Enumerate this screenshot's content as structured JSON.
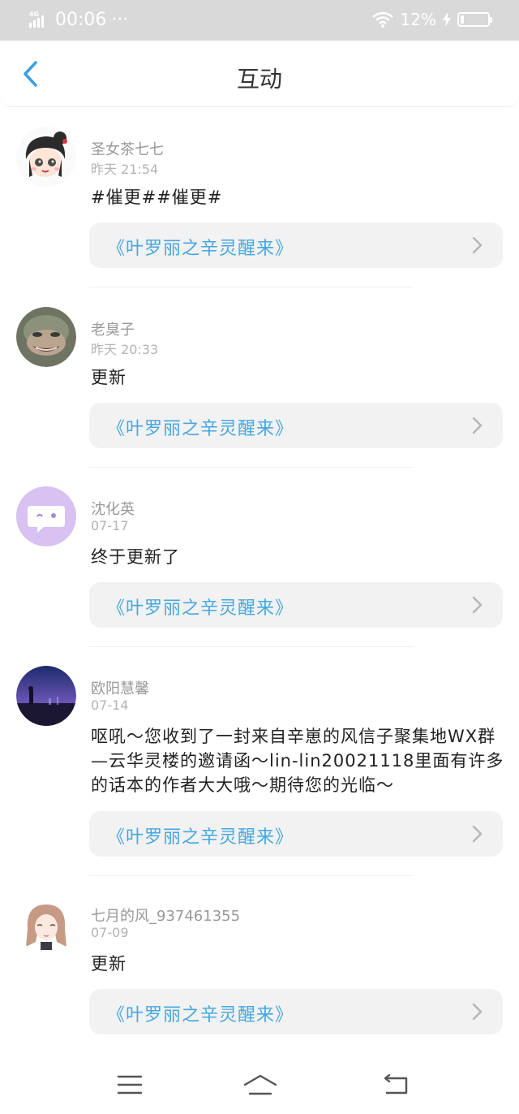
{
  "status": {
    "network": "4G HD",
    "time": "00:06",
    "dots": "···",
    "battery": "12%"
  },
  "header": {
    "title": "互动"
  },
  "posts": [
    {
      "name": "圣女茶七七",
      "time": "昨天 21:54",
      "content": "#催更##催更#",
      "book": "《叶罗丽之辛灵醒来》"
    },
    {
      "name": "老臭子",
      "time": "昨天 20:33",
      "content": "更新",
      "book": "《叶罗丽之辛灵醒来》"
    },
    {
      "name": "沈化英",
      "time": "07-17",
      "content": "终于更新了",
      "book": "《叶罗丽之辛灵醒来》"
    },
    {
      "name": "欧阳慧馨",
      "time": "07-14",
      "content": "呕吼～您收到了一封来自辛崽的风信子聚集地WX群—云华灵楼的邀请函～lin-lin20021118里面有许多的话本的作者大大哦～期待您的光临～",
      "book": "《叶罗丽之辛灵醒来》"
    },
    {
      "name": "七月的风_937461355",
      "time": "07-09",
      "content": "更新",
      "book": "《叶罗丽之辛灵醒来》"
    }
  ],
  "colors": {
    "accent": "#46a7e0",
    "statusbar": "#d9d9d9",
    "card": "#f2f2f2"
  }
}
